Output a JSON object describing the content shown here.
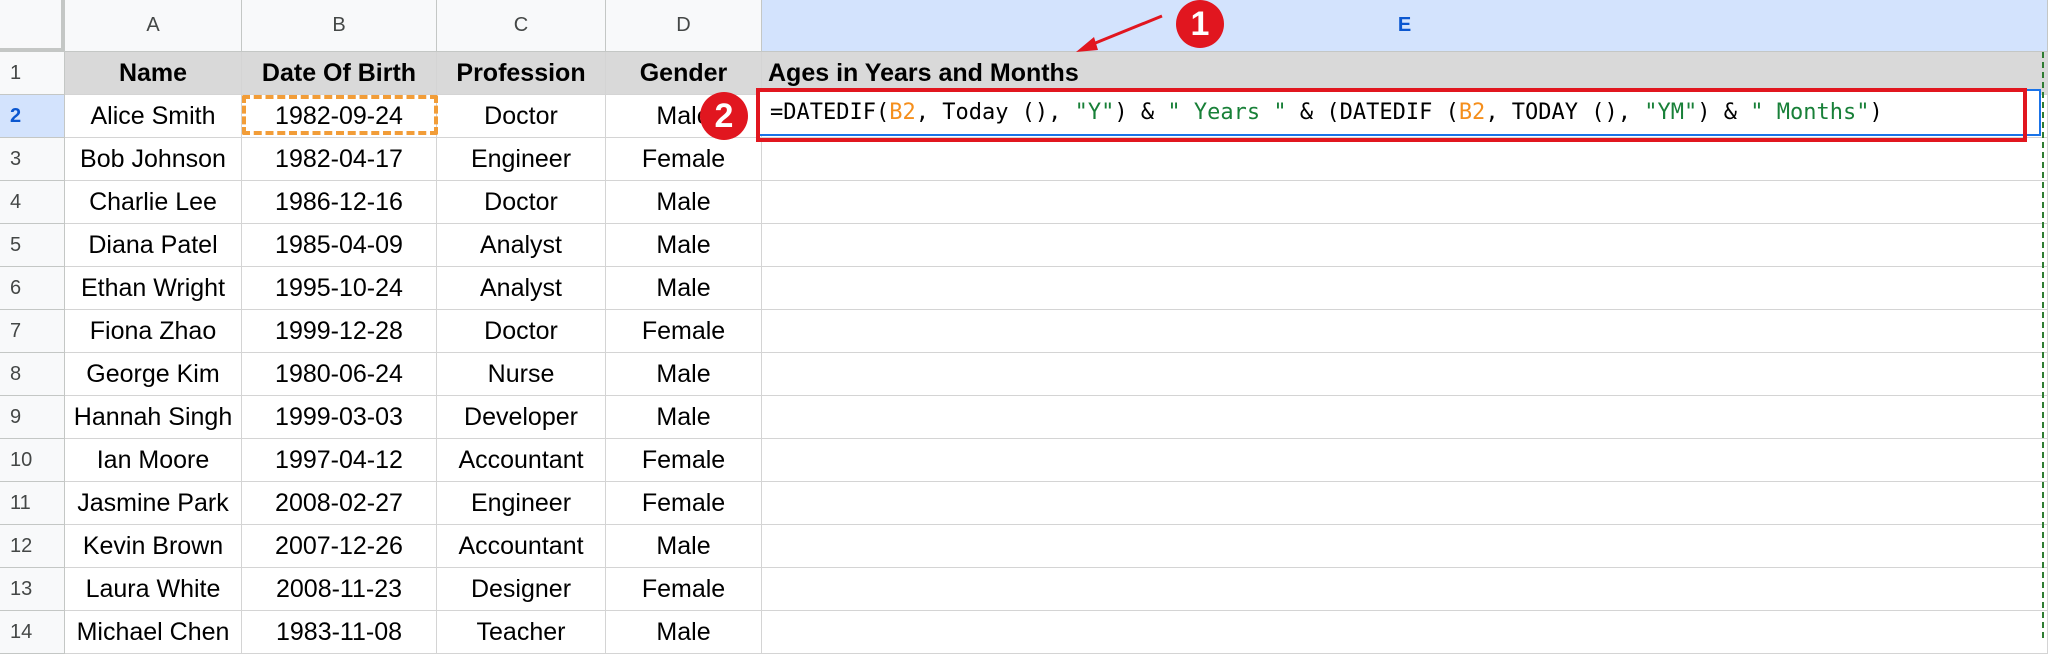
{
  "columns": [
    "A",
    "B",
    "C",
    "D",
    "E"
  ],
  "row_numbers": [
    "1",
    "2",
    "3",
    "4",
    "5",
    "6",
    "7",
    "8",
    "9",
    "10",
    "11",
    "12",
    "13",
    "14"
  ],
  "headers": {
    "a": "Name",
    "b": "Date Of Birth",
    "c": "Profession",
    "d": "Gender",
    "e": "Ages in Years and Months"
  },
  "rows": [
    {
      "name": "Alice Smith",
      "dob": "1982-09-24",
      "profession": "Doctor",
      "gender": "Male"
    },
    {
      "name": "Bob Johnson",
      "dob": "1982-04-17",
      "profession": "Engineer",
      "gender": "Female"
    },
    {
      "name": "Charlie Lee",
      "dob": "1986-12-16",
      "profession": "Doctor",
      "gender": "Male"
    },
    {
      "name": "Diana Patel",
      "dob": "1985-04-09",
      "profession": "Analyst",
      "gender": "Male"
    },
    {
      "name": "Ethan Wright",
      "dob": "1995-10-24",
      "profession": "Analyst",
      "gender": "Male"
    },
    {
      "name": "Fiona Zhao",
      "dob": "1999-12-28",
      "profession": "Doctor",
      "gender": "Female"
    },
    {
      "name": "George Kim",
      "dob": "1980-06-24",
      "profession": "Nurse",
      "gender": "Male"
    },
    {
      "name": "Hannah Singh",
      "dob": "1999-03-03",
      "profession": "Developer",
      "gender": "Male"
    },
    {
      "name": "Ian Moore",
      "dob": "1997-04-12",
      "profession": "Accountant",
      "gender": "Female"
    },
    {
      "name": "Jasmine Park",
      "dob": "2008-02-27",
      "profession": "Engineer",
      "gender": "Female"
    },
    {
      "name": "Kevin Brown",
      "dob": "2007-12-26",
      "profession": "Accountant",
      "gender": "Male"
    },
    {
      "name": "Laura White",
      "dob": "2008-11-23",
      "profession": "Designer",
      "gender": "Female"
    },
    {
      "name": "Michael Chen",
      "dob": "1983-11-08",
      "profession": "Teacher",
      "gender": "Male"
    }
  ],
  "formula_parts": [
    {
      "text": "=DATEDIF(",
      "kind": "plain"
    },
    {
      "text": "B2",
      "kind": "ref"
    },
    {
      "text": ", Today (), ",
      "kind": "plain"
    },
    {
      "text": "\"Y\"",
      "kind": "str"
    },
    {
      "text": ") & ",
      "kind": "plain"
    },
    {
      "text": "\" Years \"",
      "kind": "str"
    },
    {
      "text": " & (DATEDIF (",
      "kind": "plain"
    },
    {
      "text": "B2",
      "kind": "ref"
    },
    {
      "text": ", TODAY (), ",
      "kind": "plain"
    },
    {
      "text": "\"YM\"",
      "kind": "str"
    },
    {
      "text": ") & ",
      "kind": "plain"
    },
    {
      "text": "\" Months\"",
      "kind": "str"
    },
    {
      "text": ")",
      "kind": "plain"
    }
  ],
  "badges": {
    "one": "1",
    "two": "2"
  },
  "colors": {
    "annotation_red": "#e1161f",
    "ref_orange": "#f58f1c",
    "string_green": "#188038",
    "selection_blue": "#1a73e8"
  }
}
